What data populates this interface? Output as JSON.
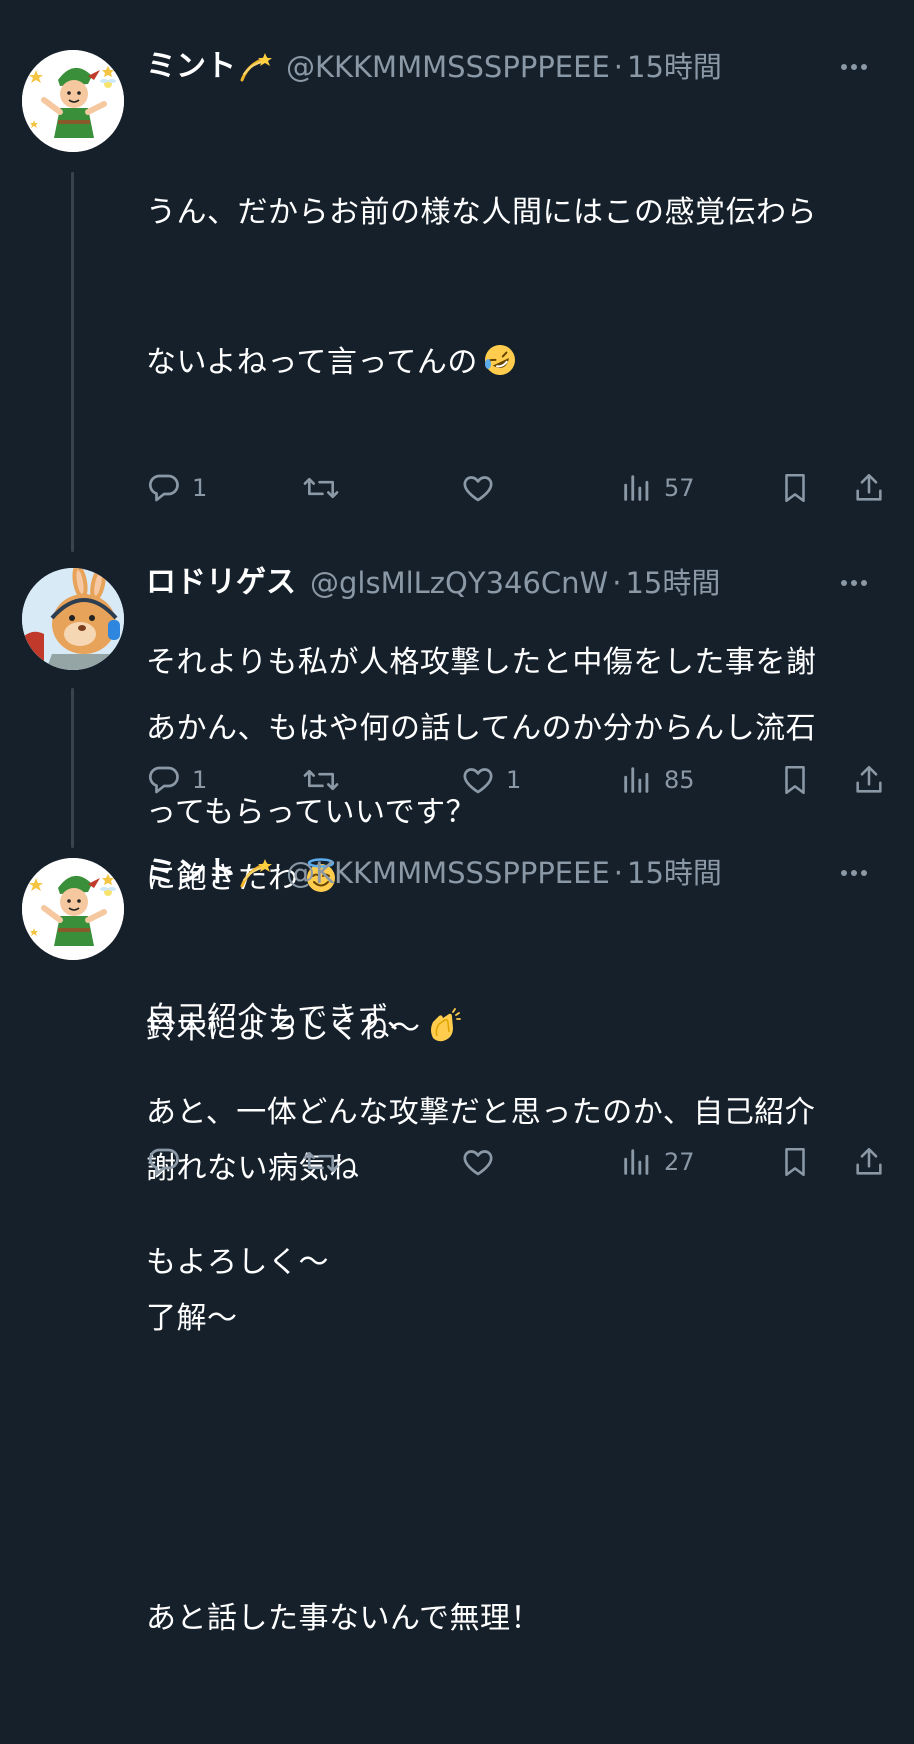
{
  "tweets": [
    {
      "display_name": "ミント",
      "name_icon": "dizzy-emoji",
      "handle": "@KKKMMMSSSPPPEEE",
      "time": "15時間",
      "lines": [
        "うん、だからお前の様な人間にはこの感覚伝わら",
        "ないよねって言ってんの",
        "",
        "それよりも私が人格攻撃したと中傷をした事を謝",
        "ってもらっていいです？",
        "",
        "あと、一体どんな攻撃だと思ったのか、自己紹介",
        "もよろしく〜"
      ],
      "reply_count": "1",
      "retweet_count": "",
      "like_count": "",
      "view_count": "57"
    },
    {
      "display_name": "ロドリゲス",
      "handle": "@glsMlLzQY346CnW",
      "time": "15時間",
      "lines": [
        "あかん、もはや何の話してんのか分からんし流石",
        "に飽きたわ",
        "鈴木によろしくね〜"
      ],
      "reply_count": "1",
      "retweet_count": "",
      "like_count": "1",
      "view_count": "85"
    },
    {
      "display_name": "ミント",
      "name_icon": "dizzy-emoji",
      "handle": "@KKKMMMSSSPPPEEE",
      "time": "15時間",
      "lines": [
        "自己紹介もできず、",
        "謝れない病気ね",
        "了解〜",
        "",
        "あと話した事ないんで無理！"
      ],
      "reply_count": "",
      "retweet_count": "",
      "like_count": "",
      "view_count": "27"
    }
  ],
  "separator": "·",
  "icons": {
    "reply": "reply-icon",
    "retweet": "retweet-icon",
    "like": "heart-icon",
    "views": "views-icon",
    "bookmark": "bookmark-icon",
    "share": "share-icon",
    "more": "more-icon"
  },
  "colors": {
    "background": "#15202b",
    "text": "#ffffff",
    "secondary": "#8b98a5",
    "thread_line": "#38444d"
  }
}
